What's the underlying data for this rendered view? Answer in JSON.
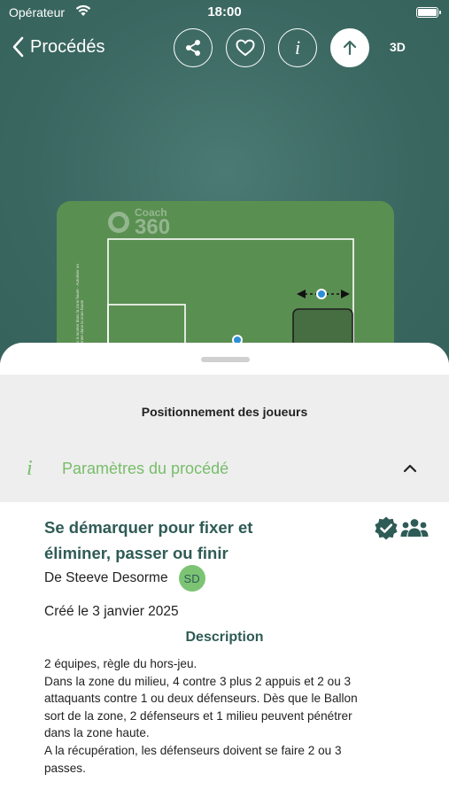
{
  "status_bar": {
    "carrier": "Opérateur",
    "time": "18:00"
  },
  "nav": {
    "back_label": "Procédés",
    "buttons": {
      "share_icon": "share-icon",
      "favorite_icon": "heart-icon",
      "info_label": "i",
      "upload_icon": "arrow-up-icon",
      "view_3d_label": "3D"
    }
  },
  "field": {
    "logo_line1": "Coach",
    "logo_line2": "360",
    "side_text": "Autoriser appuis à monter dans la zone haute · Autoriser un défenseur à monter dans la zone haute"
  },
  "sheet": {
    "title": "Positionnement des joueurs",
    "params_icon": "i",
    "params_label": "Paramètres du procédé"
  },
  "drill": {
    "title": "Se démarquer pour fixer et éliminer, passer ou finir",
    "author": "De Steeve Desorme",
    "author_initials": "SD",
    "created": "Créé le 3 janvier 2025",
    "description_heading": "Description",
    "description_lines": [
      "2 équipes, règle du hors-jeu.",
      "Dans la zone du milieu, 4 contre 3 plus 2 appuis et 2 ou 3",
      "attaquants contre 1 ou deux défenseurs. Dès que le Ballon",
      "sort de la zone, 2 défenseurs et 1 milieu peuvent pénétrer",
      "dans la zone haute.",
      "A la récupération, les défenseurs doivent se faire 2 ou 3",
      "passes."
    ]
  },
  "colors": {
    "header_bg": "#3e6b65",
    "accent_green": "#78bd6a",
    "dark_teal": "#2f5b56",
    "pitch": "#5a8f52"
  }
}
